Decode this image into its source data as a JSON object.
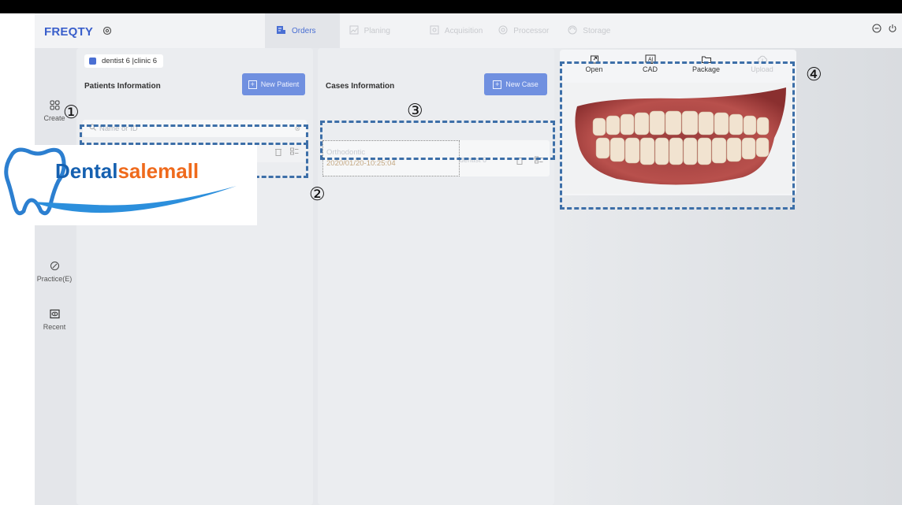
{
  "app": {
    "brand": "FREQTY",
    "brand_icon": "gear-icon"
  },
  "nav": {
    "tabs": [
      {
        "label": "Orders",
        "icon": "orders-icon",
        "active": true
      },
      {
        "label": "Planing",
        "icon": "planning-icon",
        "active": false
      },
      {
        "label": "Acquisition",
        "icon": "acquisition-icon",
        "active": false
      },
      {
        "label": "Processor",
        "icon": "processor-icon",
        "active": false
      },
      {
        "label": "Storage",
        "icon": "storage-icon",
        "active": false
      }
    ]
  },
  "window": {
    "minimize_icon": "minimize-icon",
    "power_icon": "power-icon"
  },
  "rail": {
    "items": [
      {
        "label": "Create",
        "icon": "grid-icon"
      },
      {
        "label": "Practice(E)",
        "icon": "practice-icon"
      },
      {
        "label": "Recent",
        "icon": "eye-icon"
      }
    ]
  },
  "patients": {
    "account": "dentist 6 |clinic 6",
    "title": "Patients Information",
    "new_button": "New Patient",
    "search_placeholder": "Name or ID"
  },
  "cases": {
    "title": "Cases Information",
    "new_button": "New Case",
    "row": {
      "type": "Orthodontic",
      "date": "2020/01/20-10:25:04",
      "doctor": "dentist 6"
    }
  },
  "preview": {
    "tools": [
      {
        "label": "Open",
        "icon": "open-icon",
        "enabled": true
      },
      {
        "label": "CAD",
        "icon": "cad-icon",
        "enabled": true
      },
      {
        "label": "Package",
        "icon": "package-icon",
        "enabled": true
      },
      {
        "label": "Upload",
        "icon": "upload-icon",
        "enabled": false
      }
    ]
  },
  "annotations": [
    "①",
    "②",
    "③",
    "④"
  ],
  "watermark": {
    "brand_a": "Dental",
    "brand_b": "salemall",
    "colors": {
      "blue": "#1560b0",
      "orange": "#ef6a1c"
    }
  },
  "colors": {
    "accent": "#4a6fd3",
    "button": "#7090e0",
    "annotation_dash": "#3d6fa8"
  }
}
